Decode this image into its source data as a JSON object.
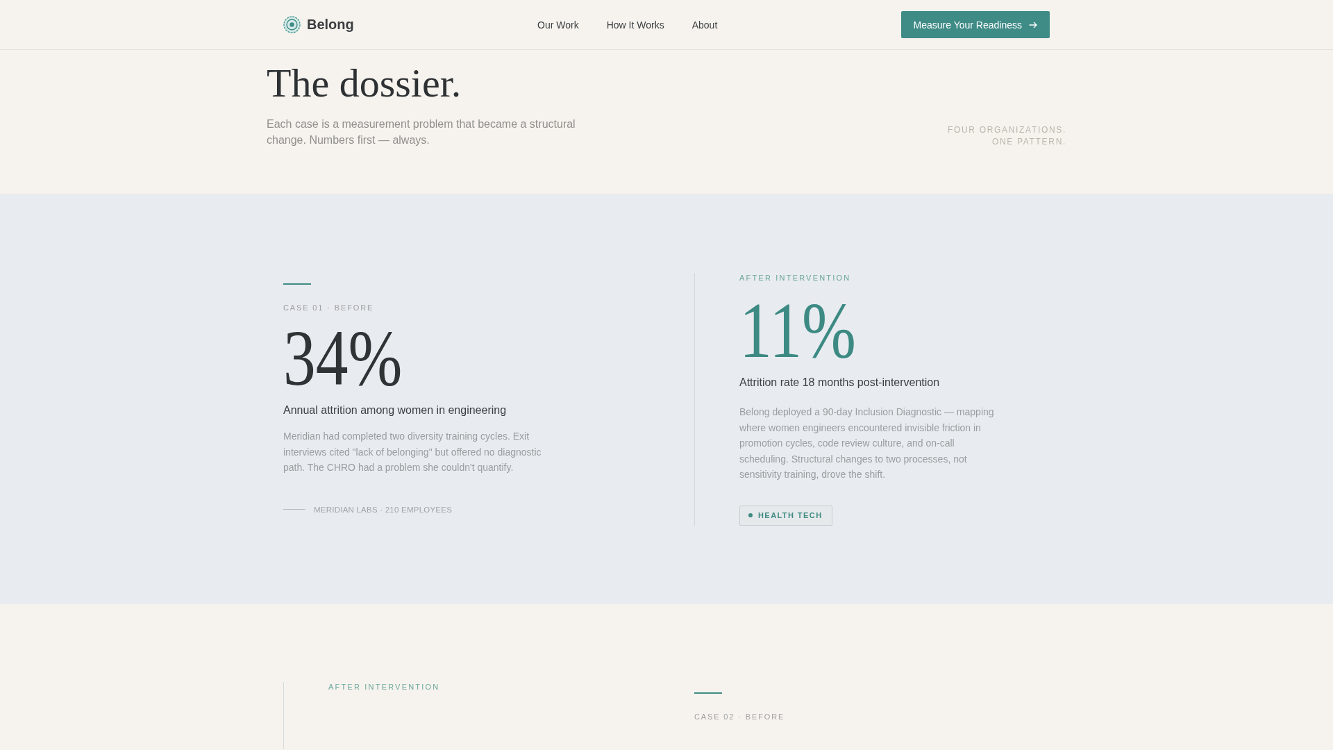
{
  "header": {
    "brand": "Belong",
    "nav": [
      {
        "label": "Our Work"
      },
      {
        "label": "How It Works"
      },
      {
        "label": "About"
      }
    ],
    "cta": {
      "label": "Measure Your Readiness"
    }
  },
  "hero": {
    "title": "The dossier.",
    "subtitle": "Each case is a measurement problem that became a structural change. Numbers first — always.",
    "tagline": "FOUR ORGANIZATIONS. ONE PATTERN."
  },
  "cases": [
    {
      "panels": [
        {
          "kind": "before",
          "label": "CASE 01 · BEFORE",
          "figure": "34%",
          "heading": "Annual attrition among women in engineering",
          "body": "Meridian had completed two diversity training cycles. Exit interviews cited \"lack of belonging\" but offered no diagnostic path. The CHRO had a problem she couldn't quantify.",
          "meta": "MERIDIAN LABS · 210 EMPLOYEES"
        },
        {
          "kind": "after",
          "label": "AFTER INTERVENTION",
          "figure": "11%",
          "heading": "Attrition rate 18 months post-intervention",
          "body": "Belong deployed a 90-day Inclusion Diagnostic — mapping where women engineers encountered invisible friction in promotion cycles, code review culture, and on-call scheduling. Structural changes to two processes, not sensitivity training, drove the shift.",
          "tag": "HEALTH TECH"
        }
      ]
    },
    {
      "panels": [
        {
          "kind": "after",
          "label": "AFTER INTERVENTION"
        },
        {
          "kind": "before",
          "label": "CASE 02 · BEFORE"
        }
      ]
    }
  ]
}
